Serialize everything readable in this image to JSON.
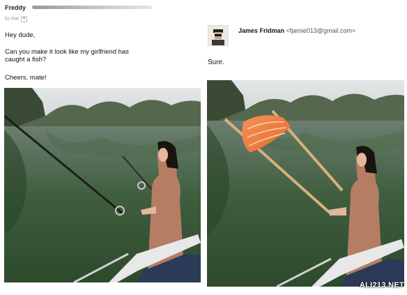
{
  "original_email": {
    "sender_name": "Freddy",
    "recipient_label": "to me",
    "greeting": "Hey dude,",
    "body_line1": "Can you make it look like my girlfriend has",
    "body_line2": "caught a fish?",
    "signoff": "Cheers, mate!"
  },
  "reply_email": {
    "sender_name": "James Fridman",
    "sender_email": "<fjamie013@gmail.com>",
    "body": "Sure."
  },
  "watermark": "ALI213.NET",
  "colors": {
    "water": "#41603e",
    "sky": "#d8dde0",
    "dress": "#b07a62",
    "fish": "#f07a3a"
  }
}
